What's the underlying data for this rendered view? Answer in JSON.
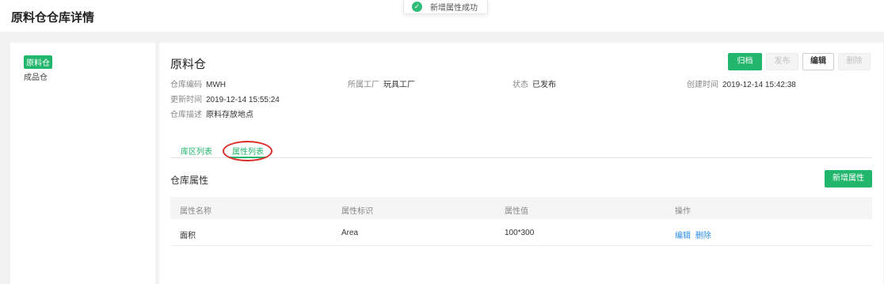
{
  "page": {
    "title": "原料仓仓库详情"
  },
  "toast": {
    "icon": "check-circle-icon",
    "message": "新增属性成功"
  },
  "sidebar": {
    "items": [
      {
        "label": "原料仓",
        "active": true
      },
      {
        "label": "成品仓",
        "active": false
      }
    ]
  },
  "warehouse": {
    "name": "原料仓",
    "code_label": "仓库编码",
    "code": "MWH",
    "factory_label": "所属工厂",
    "factory": "玩具工厂",
    "status_label": "状态",
    "status": "已发布",
    "created_label": "创建时间",
    "created": "2019-12-14 15:42:38",
    "updated_label": "更新时间",
    "updated": "2019-12-14 15:55:24",
    "desc_label": "仓库描述",
    "desc": "原料存放地点"
  },
  "actions": {
    "archive": "归档",
    "publish": "发布",
    "edit": "编辑",
    "delete": "删除"
  },
  "tabs": [
    {
      "label": "库区列表"
    },
    {
      "label": "属性列表",
      "active": true
    }
  ],
  "section": {
    "title": "仓库属性",
    "add_button": "新增属性"
  },
  "table": {
    "headers": [
      "属性名称",
      "属性标识",
      "属性值",
      "操作"
    ],
    "rows": [
      {
        "name": "面积",
        "key": "Area",
        "value": "100*300",
        "edit": "编辑",
        "delete": "删除"
      }
    ]
  },
  "colors": {
    "accent": "#22b56c",
    "link": "#2b8de6",
    "annotation": "#d9302c"
  }
}
